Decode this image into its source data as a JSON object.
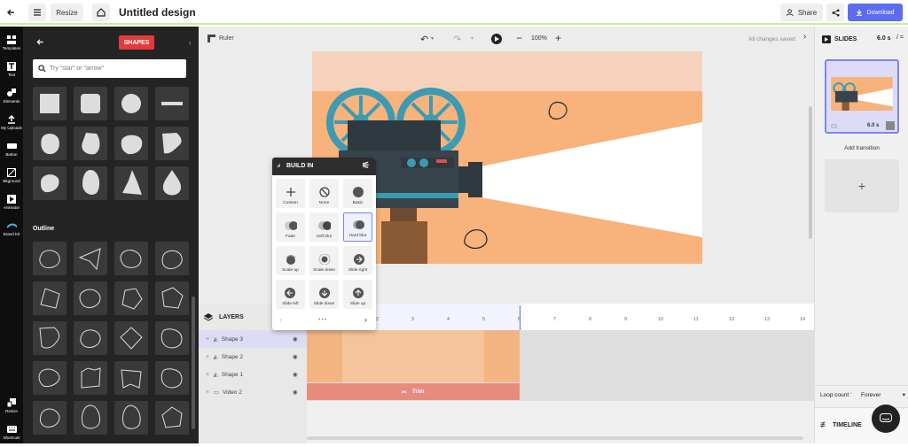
{
  "topbar": {
    "resize_label": "Resize",
    "title": "Untitled design",
    "share_label": "Share",
    "download_label": "Download"
  },
  "rail": {
    "items": [
      {
        "label": "Templates",
        "icon": "grid-icon"
      },
      {
        "label": "Text",
        "icon": "text-icon"
      },
      {
        "label": "Elements",
        "icon": "shapes-icon"
      },
      {
        "label": "My Uploads",
        "icon": "upload-icon"
      },
      {
        "label": "Button",
        "icon": "button-icon"
      },
      {
        "label": "Bkground",
        "icon": "background-icon"
      },
      {
        "label": "Animator",
        "icon": "animator-icon"
      },
      {
        "label": "Brand Kit",
        "icon": "brand-kit-icon"
      },
      {
        "label": "Resize",
        "icon": "resize-icon"
      },
      {
        "label": "Shortcuts",
        "icon": "keyboard-icon"
      }
    ]
  },
  "panel": {
    "title": "SHAPES",
    "search_placeholder": "Try \"star\" or \"arrow\"",
    "outline_heading": "Outline"
  },
  "workspace": {
    "ruler_label": "Ruler",
    "zoom": "100%",
    "save_status": "All changes saved"
  },
  "build_in": {
    "title": "BUILD IN",
    "options": [
      {
        "label": "Custom",
        "icon": "plus-icon"
      },
      {
        "label": "None",
        "icon": "none-icon"
      },
      {
        "label": "Basic",
        "icon": "circle-icon"
      },
      {
        "label": "Fade",
        "icon": "fade-icon"
      },
      {
        "label": "Soft blur",
        "icon": "soft-blur-icon"
      },
      {
        "label": "Hard blur",
        "icon": "hard-blur-icon"
      },
      {
        "label": "Scale up",
        "icon": "scale-up-icon"
      },
      {
        "label": "Scale down",
        "icon": "scale-down-icon"
      },
      {
        "label": "Slide right",
        "icon": "arrow-right-icon"
      },
      {
        "label": "Slide left",
        "icon": "arrow-left-icon"
      },
      {
        "label": "Slide down",
        "icon": "arrow-down-icon"
      },
      {
        "label": "Slide up",
        "icon": "arrow-up-icon"
      }
    ],
    "selected": "Hard blur"
  },
  "timeline": {
    "layers_label": "LAYERS",
    "ruler_numbers": [
      "2",
      "3",
      "4",
      "5",
      "6",
      "7",
      "8",
      "9",
      "10",
      "11",
      "12",
      "13",
      "14"
    ],
    "layers": [
      {
        "name": "Shape 3"
      },
      {
        "name": "Shape 2"
      },
      {
        "name": "Shape 1"
      },
      {
        "name": "Video 2"
      }
    ],
    "trim_label": "Trim"
  },
  "slides": {
    "title": "SLIDES",
    "duration": "6.0 s",
    "slide_number": "01",
    "slide_duration": "6.0 s",
    "add_transition": "Add transition",
    "loop_label": "Loop count",
    "loop_value": "Forever",
    "timeline_label": "TIMELINE"
  },
  "colors": {
    "accent": "#5b6cf0",
    "shapes_badge": "#e23b3b",
    "canvas_orange": "#f8b27b",
    "canvas_peach": "#f6d2bd",
    "projector_teal": "#3c9bb3",
    "track_orange": "#f6c49a",
    "track_red": "#e88b7f"
  }
}
